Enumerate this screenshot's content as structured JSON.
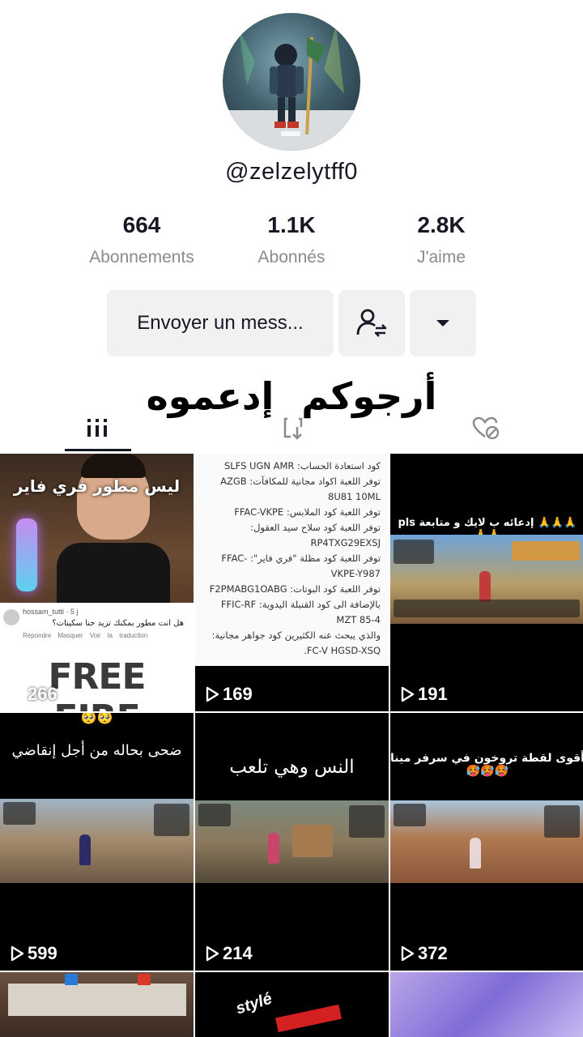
{
  "profile": {
    "username": "@zelzelytff0",
    "stats": [
      {
        "value": "664",
        "label": "Abonnements"
      },
      {
        "value": "1.1K",
        "label": "Abonnés"
      },
      {
        "value": "2.8K",
        "label": "J'aime"
      }
    ],
    "message_button": "Envoyer un mess...",
    "overlay_caption": "أرجوكم إدعموه"
  },
  "tabs": [
    {
      "icon": "grid-icon",
      "active": true
    },
    {
      "icon": "repost-icon",
      "active": false
    },
    {
      "icon": "liked-hidden-icon",
      "active": false
    }
  ],
  "videos": [
    {
      "views": "266",
      "caption": "ليس مطور فري فاير",
      "comment_user": "hossam_tutti",
      "comment_time": "5 j",
      "comment_text": "هل انت مطور بمكنك تزيد حنا سكينات؟",
      "comment_actions": [
        "Répondre",
        "Masquer",
        "Voir la traduction"
      ],
      "banner": "FREE FIRE"
    },
    {
      "views": "169",
      "doc_lines": [
        "كود استعادة الحساب: SLFS UGN AMR",
        "توفر اللعبة اكواد مجانية للمكافآت: AZGB",
        "8U81 10ML",
        "توفر اللعبة كود الملابس: FFAC-VKPE",
        "توفر اللعبة كود سلاح سيد العقول:",
        "RP4TXG29EXSJ",
        "توفر اللعبة كود مظلة \"فري فاير\": -FFAC",
        "VKPE-Y987",
        "توفر اللعبة كود البوتات: F2PMABG1OABG",
        "بالإضافة الى كود القنبلة اليدوية: FFIC-RF",
        "85-4 MZT",
        "والذي يبحث عنه الكثيرين كود جواهر مجانية:",
        "FC-V HGSD-XSQ."
      ]
    },
    {
      "views": "191",
      "caption": "🙏🙏🙏 إدعائه ب لايك و متابعة pls 🙏🙏"
    },
    {
      "views": "599",
      "caption": "ضحى بحاله من أجل إنقاضي",
      "emoji": "🥺🥺"
    },
    {
      "views": "214",
      "caption": "النس وهي تلعب"
    },
    {
      "views": "372",
      "caption": "أقوى لقطة تروخون في سرفر مينا 🥵🥵🥵"
    },
    {
      "views": "",
      "caption": ""
    },
    {
      "views": "",
      "caption": "stylé"
    },
    {
      "views": "",
      "caption": ""
    }
  ],
  "colors": {
    "text_primary": "#161823",
    "text_secondary": "#8a8b91",
    "button_bg": "#f1f1f2"
  }
}
